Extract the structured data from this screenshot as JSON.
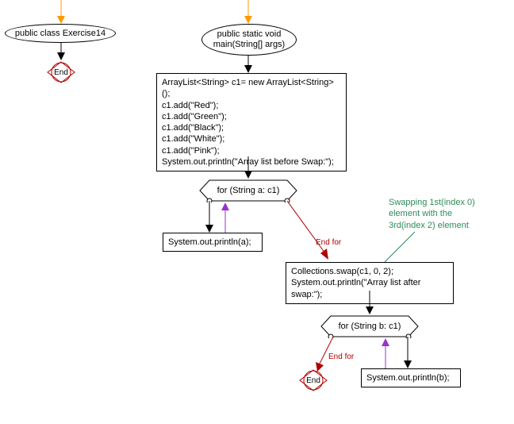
{
  "class_decl": "public class Exercise14",
  "end_label": "End",
  "method_decl_l1": "public static void",
  "method_decl_l2": "main(String[] args)",
  "block1_lines": [
    "ArrayList<String> c1= new ArrayList<String>();",
    "c1.add(\"Red\");",
    "c1.add(\"Green\");",
    "c1.add(\"Black\");",
    "c1.add(\"White\");",
    "c1.add(\"Pink\");",
    "System.out.println(\"Array list before Swap:\");"
  ],
  "for1": "for (String a: c1)",
  "print_a": "System.out.println(a);",
  "end_for": "End for",
  "block2_lines": [
    "Collections.swap(c1, 0, 2);",
    "System.out.println(\"Array list after swap:\");"
  ],
  "comment_lines": [
    "Swapping 1st(index 0)",
    "element with the",
    "3rd(index 2) element"
  ],
  "for2": "for (String b: c1)",
  "print_b": "System.out.println(b);",
  "colors": {
    "entry": "#ff9900",
    "loop_back": "#9933cc",
    "end_for": "#b00000",
    "comment_line": "#2e8b57"
  }
}
